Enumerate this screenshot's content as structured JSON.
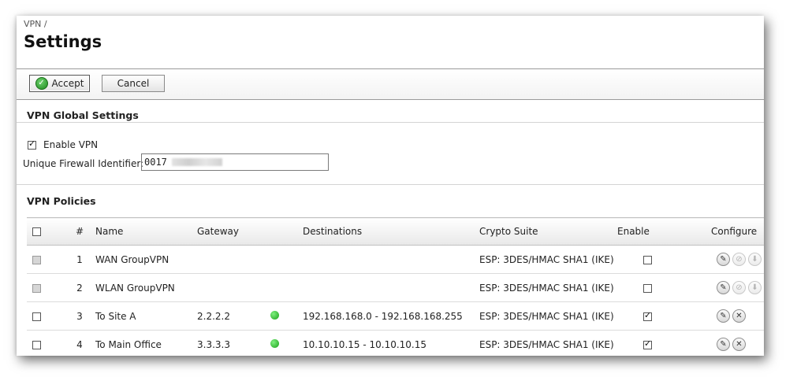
{
  "breadcrumb": "VPN /",
  "title": "Settings",
  "toolbar": {
    "accept_label": "Accept",
    "cancel_label": "Cancel"
  },
  "global": {
    "section_title": "VPN Global Settings",
    "enable_label": "Enable VPN",
    "enable_checked": true,
    "fid_label": "Unique Firewall Identifier:",
    "fid_value": "0017"
  },
  "policies": {
    "section_title": "VPN Policies",
    "columns": [
      "#",
      "Name",
      "Gateway",
      "Destinations",
      "Crypto Suite",
      "Enable",
      "Configure"
    ],
    "rows": [
      {
        "num": "1",
        "name": "WAN GroupVPN",
        "gateway": "",
        "status": false,
        "destinations": "",
        "crypto": "ESP: 3DES/HMAC SHA1 (IKE)",
        "enabled": false,
        "select_disabled": true,
        "actions": "edit-disable-export"
      },
      {
        "num": "2",
        "name": "WLAN GroupVPN",
        "gateway": "",
        "status": false,
        "destinations": "",
        "crypto": "ESP: 3DES/HMAC SHA1 (IKE)",
        "enabled": false,
        "select_disabled": true,
        "actions": "edit-disable-export"
      },
      {
        "num": "3",
        "name": "To Site A",
        "gateway": "2.2.2.2",
        "status": true,
        "destinations": "192.168.168.0 - 192.168.168.255",
        "crypto": "ESP: 3DES/HMAC SHA1 (IKE)",
        "enabled": true,
        "select_disabled": false,
        "actions": "edit-delete"
      },
      {
        "num": "4",
        "name": "To Main Office",
        "gateway": "3.3.3.3",
        "status": true,
        "destinations": "10.10.10.15 - 10.10.10.15",
        "crypto": "ESP: 3DES/HMAC SHA1 (IKE)",
        "enabled": true,
        "select_disabled": false,
        "actions": "edit-delete"
      }
    ]
  },
  "colors": {
    "status_green": "#1aa01a",
    "accept_icon": "#1e8a1e"
  }
}
